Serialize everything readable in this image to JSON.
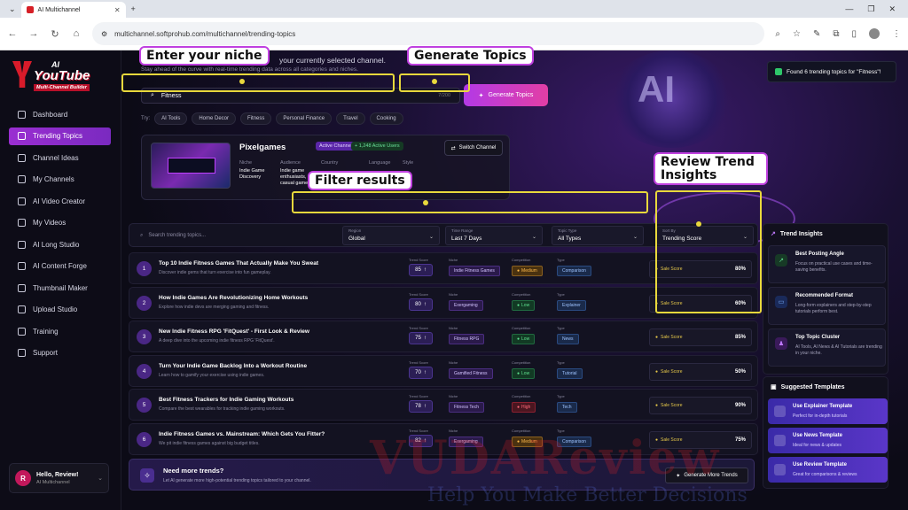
{
  "browser": {
    "tab_title": "AI Multichannel",
    "url": "multichannel.softprohub.com/multichannel/trending-topics"
  },
  "sidebar": {
    "logo_ai": "AI",
    "logo_brand": "YouTube",
    "logo_sub": "Multi-Channel Builder",
    "items": [
      {
        "label": "Dashboard"
      },
      {
        "label": "Trending Topics"
      },
      {
        "label": "Channel Ideas"
      },
      {
        "label": "My Channels"
      },
      {
        "label": "AI Video Creator"
      },
      {
        "label": "My Videos"
      },
      {
        "label": "AI Long Studio"
      },
      {
        "label": "AI Content Forge"
      },
      {
        "label": "Thumbnail Maker"
      },
      {
        "label": "Upload Studio"
      },
      {
        "label": "Training"
      },
      {
        "label": "Support"
      }
    ],
    "user": {
      "initial": "R",
      "name": "Hello, Review!",
      "sub": "AI Multichannel"
    }
  },
  "header": {
    "intro_line1": "your currently selected channel.",
    "intro_line2": "Stay ahead of the curve with real-time trending data across all categories and niches.",
    "niche_value": "Fitness",
    "char_count": "7/200",
    "generate_label": "Generate Topics",
    "try_label": "Try:",
    "chips": [
      "AI Tools",
      "Home Decor",
      "Fitness",
      "Personal Finance",
      "Travel",
      "Cooking"
    ],
    "bulb_text": "AI"
  },
  "toast": {
    "text": "Found 6 trending topics for \"Fitness\"!"
  },
  "channel": {
    "name": "Pixelgames",
    "active_badge": "Active Channel",
    "users_badge": "+ 1,248 Active Users",
    "switch_label": "Switch Channel",
    "niche_key": "Niche",
    "niche_val": "Indie Game Discovery",
    "audience_key": "Audience",
    "audience_val": "Indie game enthusiasts, casual gamers",
    "country_key": "Country",
    "language_key": "Language",
    "style_key": "Style"
  },
  "filters": {
    "search_placeholder": "Search trending topics...",
    "region_key": "Region",
    "region_val": "Global",
    "time_key": "Time Range",
    "time_val": "Last 7 Days",
    "topic_key": "Topic Type",
    "topic_val": "All Types",
    "sort_key": "Sort By",
    "sort_val": "Trending Score"
  },
  "col_labels": {
    "score": "Trend Score",
    "niche": "Niche",
    "comp": "Competition",
    "type": "Type",
    "sale_label": "Sale Score"
  },
  "rows": [
    {
      "n": "1",
      "title": "Top 10 Indie Fitness Games That Actually Make You Sweat",
      "desc": "Discover indie gems that turn exercise into fun gameplay.",
      "score": "85",
      "niche": "Indie Fitness Games",
      "comp": "Medium",
      "type": "Comparison",
      "sale": "80%"
    },
    {
      "n": "2",
      "title": "How Indie Games Are Revolutionizing Home Workouts",
      "desc": "Explore how indie devs are merging gaming and fitness.",
      "score": "80",
      "niche": "Exergaming",
      "comp": "Low",
      "type": "Explainer",
      "sale": "60%"
    },
    {
      "n": "3",
      "title": "New Indie Fitness RPG 'FitQuest' - First Look & Review",
      "desc": "A deep dive into the upcoming indie fitness RPG 'FitQuest'.",
      "score": "75",
      "niche": "Fitness RPG",
      "comp": "Low",
      "type": "News",
      "sale": "85%"
    },
    {
      "n": "4",
      "title": "Turn Your Indie Game Backlog Into a Workout Routine",
      "desc": "Learn how to gamify your exercise using indie games.",
      "score": "70",
      "niche": "Gamified Fitness",
      "comp": "Low",
      "type": "Tutorial",
      "sale": "50%"
    },
    {
      "n": "5",
      "title": "Best Fitness Trackers for Indie Gaming Workouts",
      "desc": "Compare the best wearables for tracking indie gaming workouts.",
      "score": "78",
      "niche": "Fitness Tech",
      "comp": "High",
      "type": "Tech",
      "sale": "90%"
    },
    {
      "n": "6",
      "title": "Indie Fitness Games vs. Mainstream: Which Gets You Fitter?",
      "desc": "We pit indie fitness games against big budget titles.",
      "score": "82",
      "niche": "Exergaming",
      "comp": "Medium",
      "type": "Comparison",
      "sale": "75%"
    }
  ],
  "more": {
    "title": "Need more trends?",
    "sub": "Let AI generate more high-potential trending topics tailored to your channel.",
    "button": "Generate More Trends"
  },
  "insights": {
    "title": "Trend Insights",
    "items": [
      {
        "title": "Best Posting Angle",
        "desc": "Focus on practical use cases and time-saving benefits."
      },
      {
        "title": "Recommended Format",
        "desc": "Long-form explainers and step-by-step tutorials perform best."
      },
      {
        "title": "Top Topic Cluster",
        "desc": "AI Tools, AI News & AI Tutorials are trending in your niche."
      }
    ]
  },
  "templates": {
    "title": "Suggested Templates",
    "items": [
      {
        "title": "Use Explainer Template",
        "desc": "Perfect for in-depth tutorials"
      },
      {
        "title": "Use News Template",
        "desc": "Ideal for news & updates"
      },
      {
        "title": "Use Review Template",
        "desc": "Great for comparisons & reviews"
      }
    ]
  },
  "annotations": {
    "niche": "Enter your niche",
    "generate": "Generate Topics",
    "filter": "Filter results",
    "review": "Review Trend Insights"
  },
  "watermark": {
    "main": "VUDAReview",
    "sub": "Help You Make Better Decisions"
  },
  "colors": {
    "accent": "#9a2ed1",
    "annotation_box": "#e8d83c",
    "annotation_label_border": "#c040e0"
  }
}
